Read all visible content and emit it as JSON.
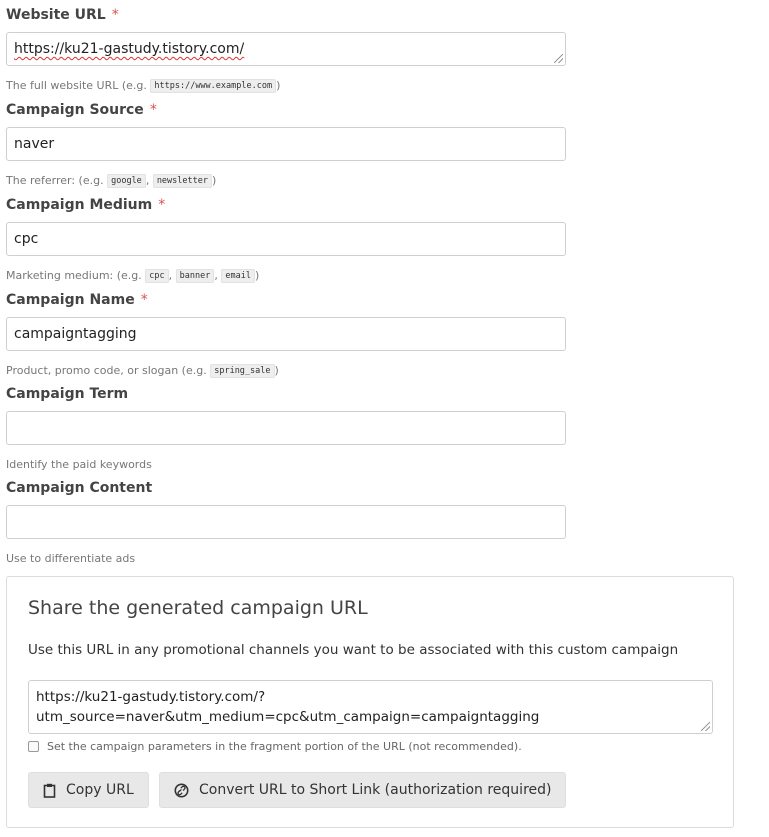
{
  "fields": [
    {
      "label": "Website URL",
      "required": "*",
      "value": "https://ku21-gastudy.tistory.com/",
      "hint_prefix": "The full website URL (e.g. ",
      "examples": [
        "https://www.example.com"
      ],
      "hint_suffix": ")"
    },
    {
      "label": "Campaign Source",
      "required": "*",
      "value": "naver",
      "hint_prefix": "The referrer: (e.g. ",
      "examples": [
        "google",
        "newsletter"
      ],
      "hint_suffix": ")"
    },
    {
      "label": "Campaign Medium",
      "required": "*",
      "value": "cpc",
      "hint_prefix": "Marketing medium: (e.g. ",
      "examples": [
        "cpc",
        "banner",
        "email"
      ],
      "hint_suffix": ")"
    },
    {
      "label": "Campaign Name",
      "required": "*",
      "value": "campaigntagging",
      "hint_prefix": "Product, promo code, or slogan (e.g. ",
      "examples": [
        "spring_sale"
      ],
      "hint_suffix": ")"
    },
    {
      "label": "Campaign Term",
      "value": "",
      "hint": "Identify the paid keywords"
    },
    {
      "label": "Campaign Content",
      "value": "",
      "hint": "Use to differentiate ads"
    }
  ],
  "share": {
    "title": "Share the generated campaign URL",
    "description": "Use this URL in any promotional channels you want to be associated with this custom campaign",
    "url_line1": "https://ku21-gastudy.tistory.com/?",
    "url_line2": "utm_source=naver&utm_medium=cpc&utm_campaign=campaigntagging",
    "fragment_checkbox_label": "Set the campaign parameters in the fragment portion of the URL (not recommended).",
    "fragment_checked": false,
    "copy_button": "Copy URL",
    "short_link_button": "Convert URL to Short Link (authorization required)"
  },
  "icons": {
    "copy": "clipboard-icon",
    "short_link": "link-icon"
  },
  "colors": {
    "required": "#d9534f",
    "button_bg": "#e8e8e8"
  }
}
